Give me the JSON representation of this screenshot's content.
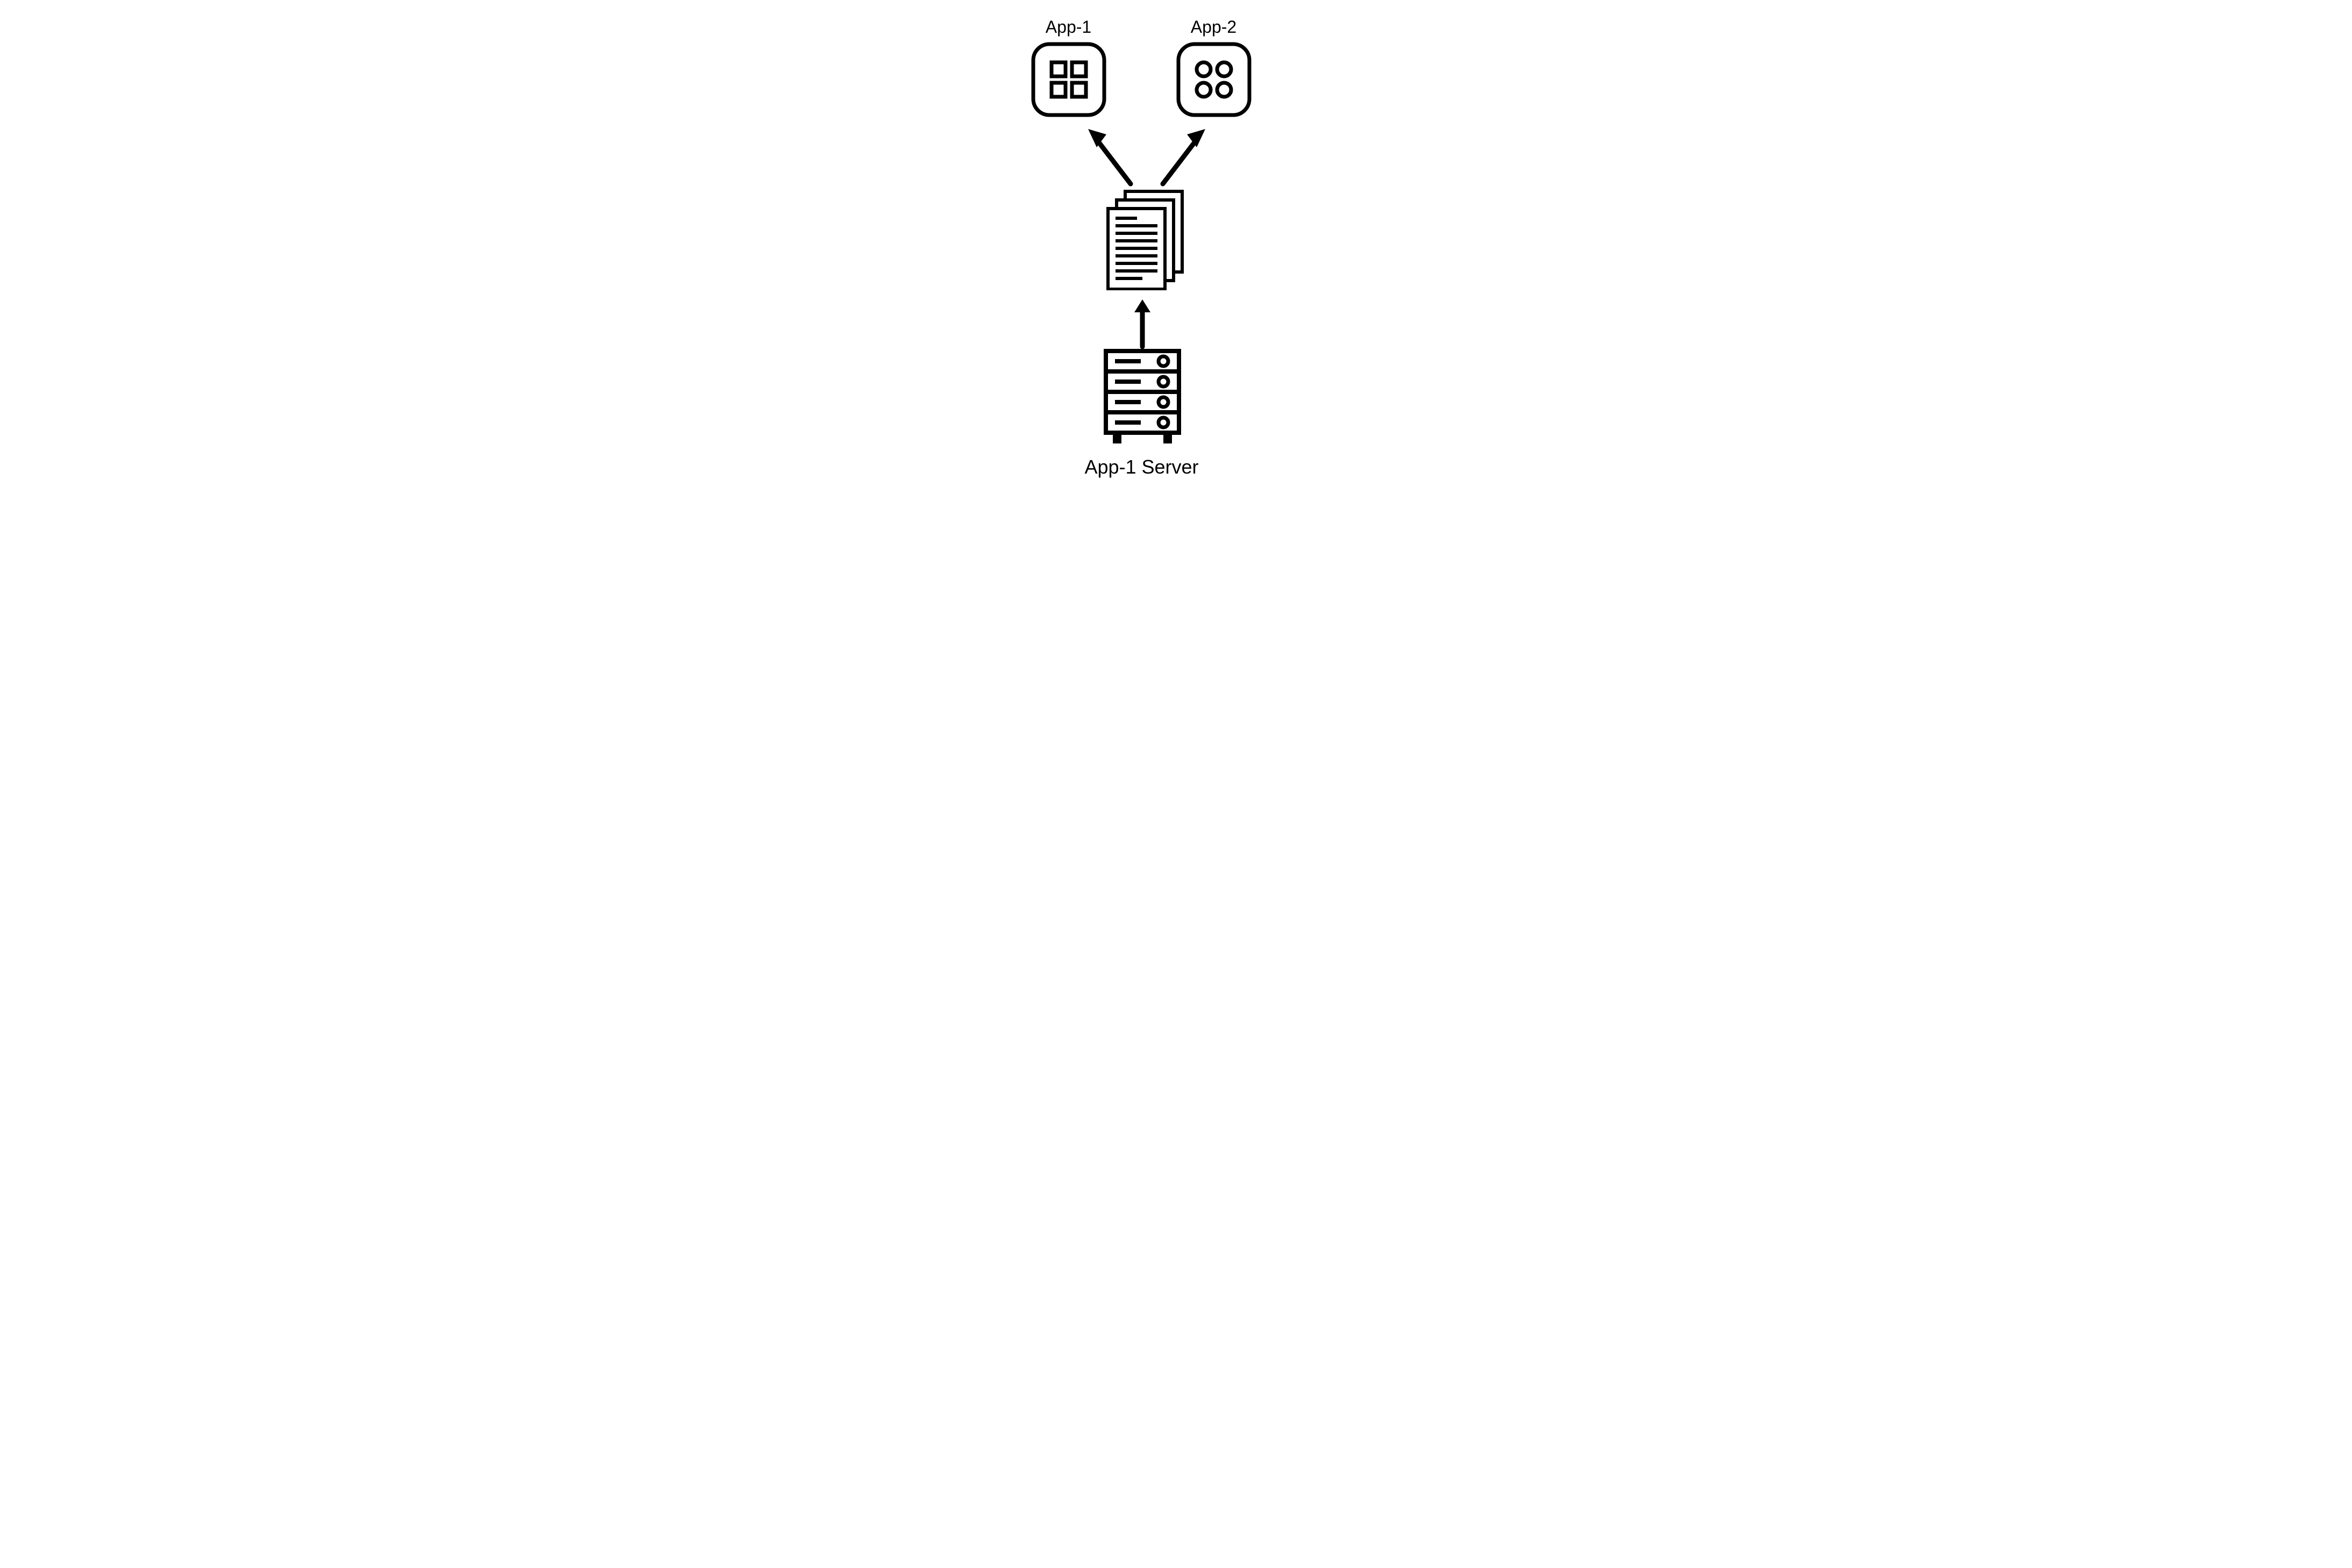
{
  "labels": {
    "app1": "App-1",
    "app2": "App-2",
    "server": "App-1 Server"
  },
  "icons": {
    "app1": "app-squares-icon",
    "app2": "app-circles-icon",
    "documents": "documents-stack-icon",
    "server": "server-rack-icon"
  },
  "colors": {
    "stroke": "#000000",
    "bg": "#ffffff"
  }
}
